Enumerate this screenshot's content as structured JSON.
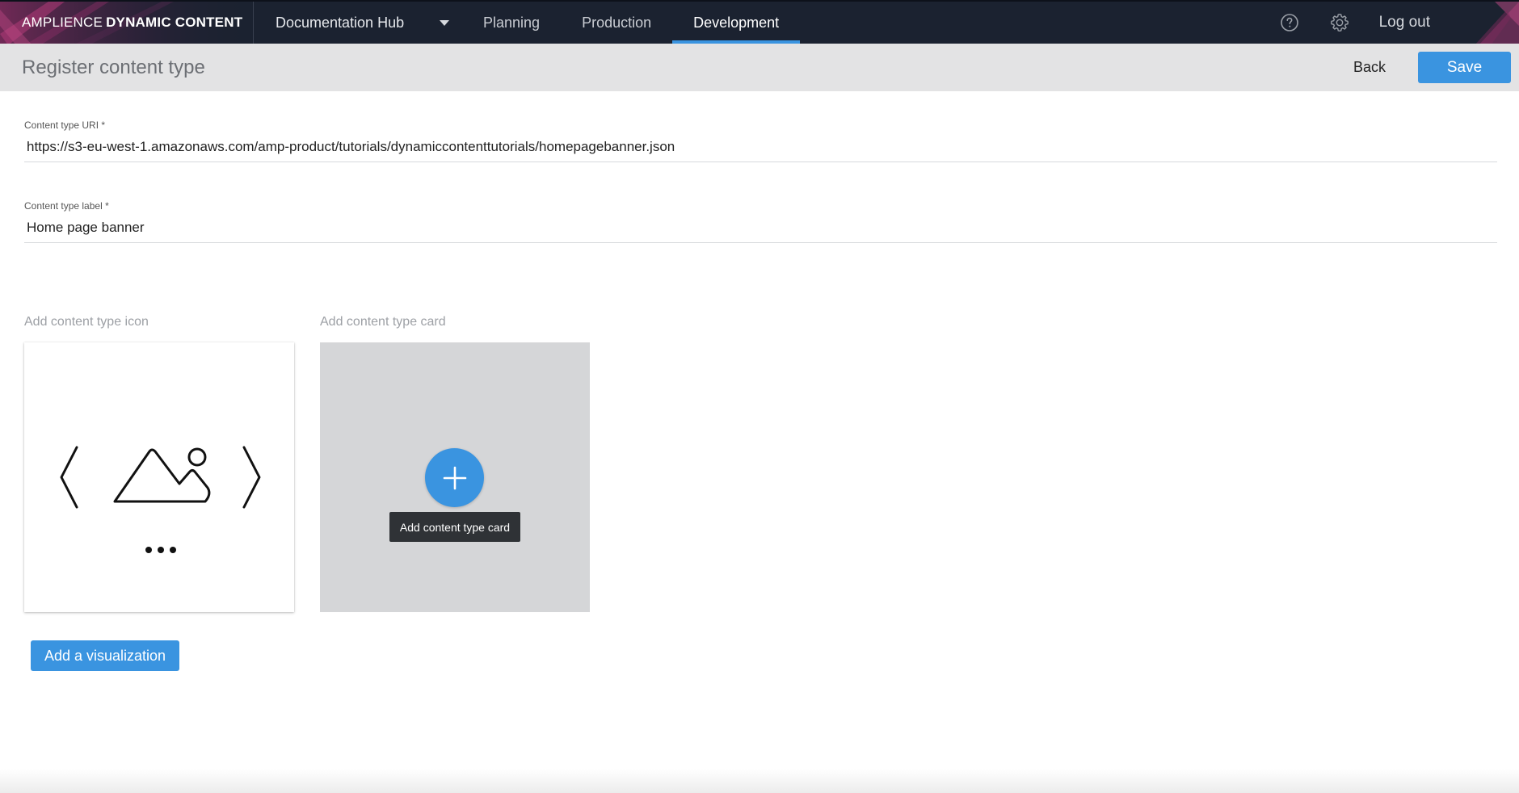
{
  "app": {
    "brand_light": "AMPLIENCE",
    "brand_strong": "DYNAMIC CONTENT"
  },
  "nav": {
    "hub_label": "Documentation Hub",
    "tabs": [
      {
        "label": "Planning",
        "active": false
      },
      {
        "label": "Production",
        "active": false
      },
      {
        "label": "Development",
        "active": true
      }
    ],
    "logout_label": "Log out",
    "icons": [
      "help-icon",
      "gear-icon",
      "chevron-down-icon"
    ]
  },
  "subheader": {
    "title": "Register content type",
    "back_label": "Back",
    "save_label": "Save"
  },
  "form": {
    "uri": {
      "label": "Content type URI *",
      "value": "https://s3-eu-west-1.amazonaws.com/amp-product/tutorials/dynamiccontenttutorials/homepagebanner.json"
    },
    "label": {
      "label": "Content type label *",
      "value": "Home page banner"
    },
    "icon_section_label": "Add content type icon",
    "card_section_label": "Add content type card",
    "card_tooltip": "Add content type card",
    "add_visualization_label": "Add a visualization"
  },
  "colors": {
    "topbar": "#1b2230",
    "accent": "#3a94e0",
    "subheader": "#e3e3e4",
    "card_placeholder": "#d5d6d8"
  }
}
